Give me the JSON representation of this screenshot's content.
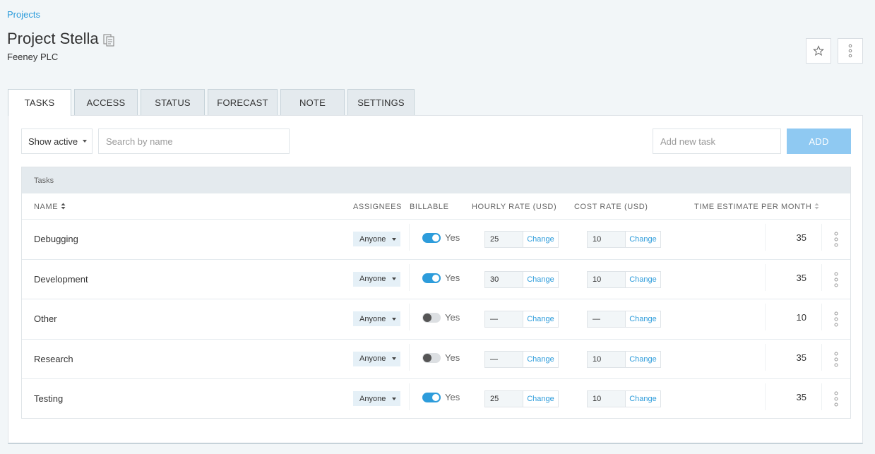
{
  "breadcrumb": "Projects",
  "page_title": "Project Stella",
  "client": "Feeney PLC",
  "tabs": [
    {
      "label": "TASKS",
      "active": true
    },
    {
      "label": "ACCESS",
      "active": false
    },
    {
      "label": "STATUS",
      "active": false
    },
    {
      "label": "FORECAST",
      "active": false
    },
    {
      "label": "NOTE",
      "active": false
    },
    {
      "label": "SETTINGS",
      "active": false
    }
  ],
  "toolbar": {
    "filter_value": "Show active",
    "search_placeholder": "Search by name",
    "add_placeholder": "Add new task",
    "add_label": "ADD"
  },
  "table": {
    "caption": "Tasks",
    "columns": {
      "name": "NAME",
      "assignees": "ASSIGNEES",
      "billable": "BILLABLE",
      "hourly_rate": "HOURLY RATE (USD)",
      "cost_rate": "COST RATE (USD)",
      "estimate": "TIME ESTIMATE PER MONTH"
    },
    "rows": [
      {
        "name": "Debugging",
        "assignee": "Anyone",
        "billable": true,
        "billable_label": "Yes",
        "hourly_rate": "25",
        "cost_rate": "10",
        "change_label": "Change",
        "estimate": "35"
      },
      {
        "name": "Development",
        "assignee": "Anyone",
        "billable": true,
        "billable_label": "Yes",
        "hourly_rate": "30",
        "cost_rate": "10",
        "change_label": "Change",
        "estimate": "35"
      },
      {
        "name": "Other",
        "assignee": "Anyone",
        "billable": false,
        "billable_label": "Yes",
        "hourly_rate": "—",
        "cost_rate": "—",
        "change_label": "Change",
        "estimate": "10"
      },
      {
        "name": "Research",
        "assignee": "Anyone",
        "billable": false,
        "billable_label": "Yes",
        "hourly_rate": "—",
        "cost_rate": "10",
        "change_label": "Change",
        "estimate": "35"
      },
      {
        "name": "Testing",
        "assignee": "Anyone",
        "billable": true,
        "billable_label": "Yes",
        "hourly_rate": "25",
        "cost_rate": "10",
        "change_label": "Change",
        "estimate": "35"
      }
    ]
  },
  "colors": {
    "accent": "#2d9cdb",
    "add_button": "#8fc9f2",
    "background": "#f2f6f8",
    "tab_inactive": "#e4eaee",
    "assignee_chip": "#e5f0f7"
  },
  "icons": {
    "copy": "copy-icon",
    "star": "star-icon",
    "more": "more-vertical-icon",
    "sort": "sort-icon",
    "caret": "caret-down-icon"
  }
}
